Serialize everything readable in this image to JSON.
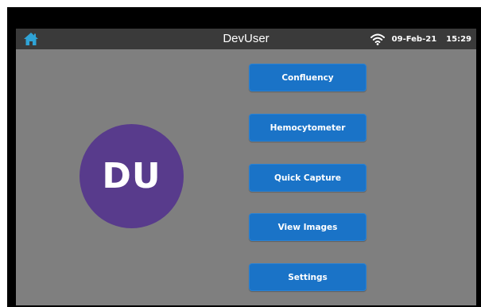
{
  "header": {
    "title": "DevUser",
    "date": "09-Feb-21",
    "time": "15:29",
    "home_icon": "home-icon",
    "wifi_icon": "wifi-icon"
  },
  "user": {
    "initials": "DU"
  },
  "menu": {
    "items": [
      {
        "label": "Confluency"
      },
      {
        "label": "Hemocytometer"
      },
      {
        "label": "Quick Capture"
      },
      {
        "label": "View Images"
      },
      {
        "label": "Settings"
      }
    ]
  },
  "colors": {
    "topbar": "#3a3a3a",
    "home_icon": "#2fa3d6",
    "screen_bg": "#7f7f7f",
    "button": "#1a73c7",
    "avatar": "#583b8c"
  }
}
